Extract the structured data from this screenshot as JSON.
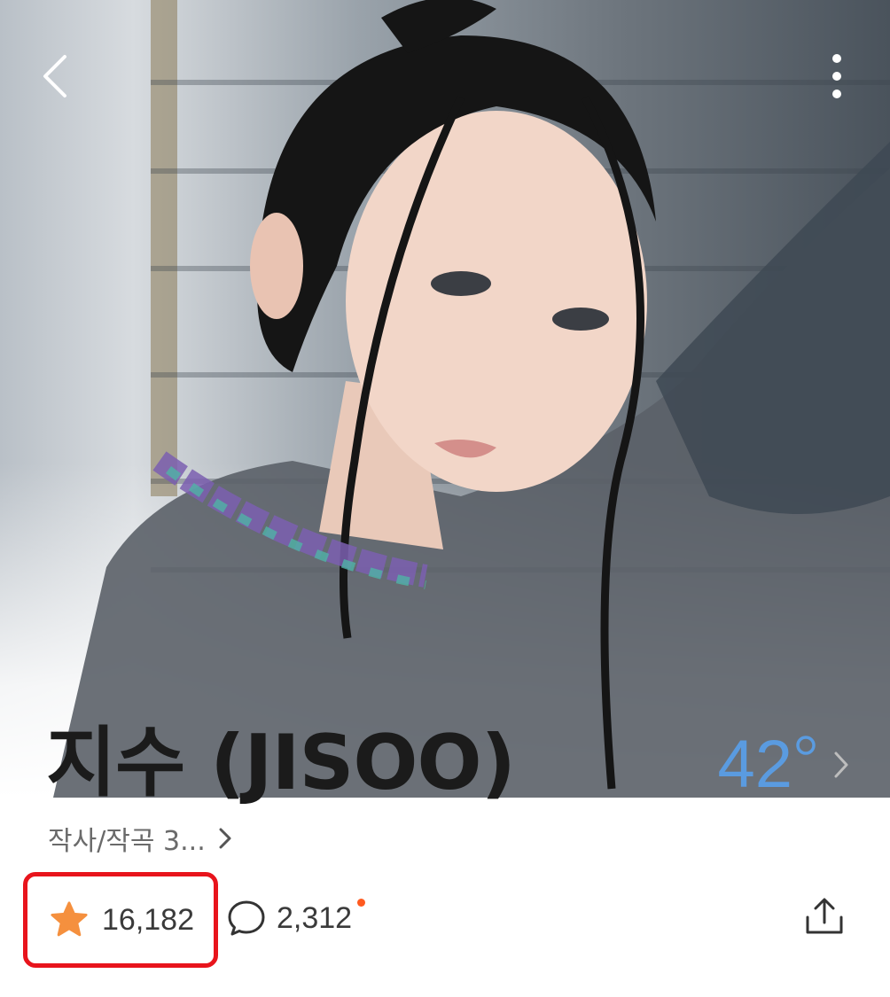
{
  "header": {
    "back_icon": "chevron-left-icon",
    "more_icon": "more-vertical-icon"
  },
  "artist": {
    "name": "지수 (JISOO)",
    "subtitle": "작사/작곡 3...",
    "temperature": "42"
  },
  "stats": {
    "likes": "16,182",
    "comments": "2,312",
    "comment_new_dot_color": "#ff5a1f",
    "star_color": "#f5903e",
    "highlight_color": "#e8141c"
  },
  "colors": {
    "temperature": "#5a9be0",
    "name_text": "#1b1b1b"
  }
}
